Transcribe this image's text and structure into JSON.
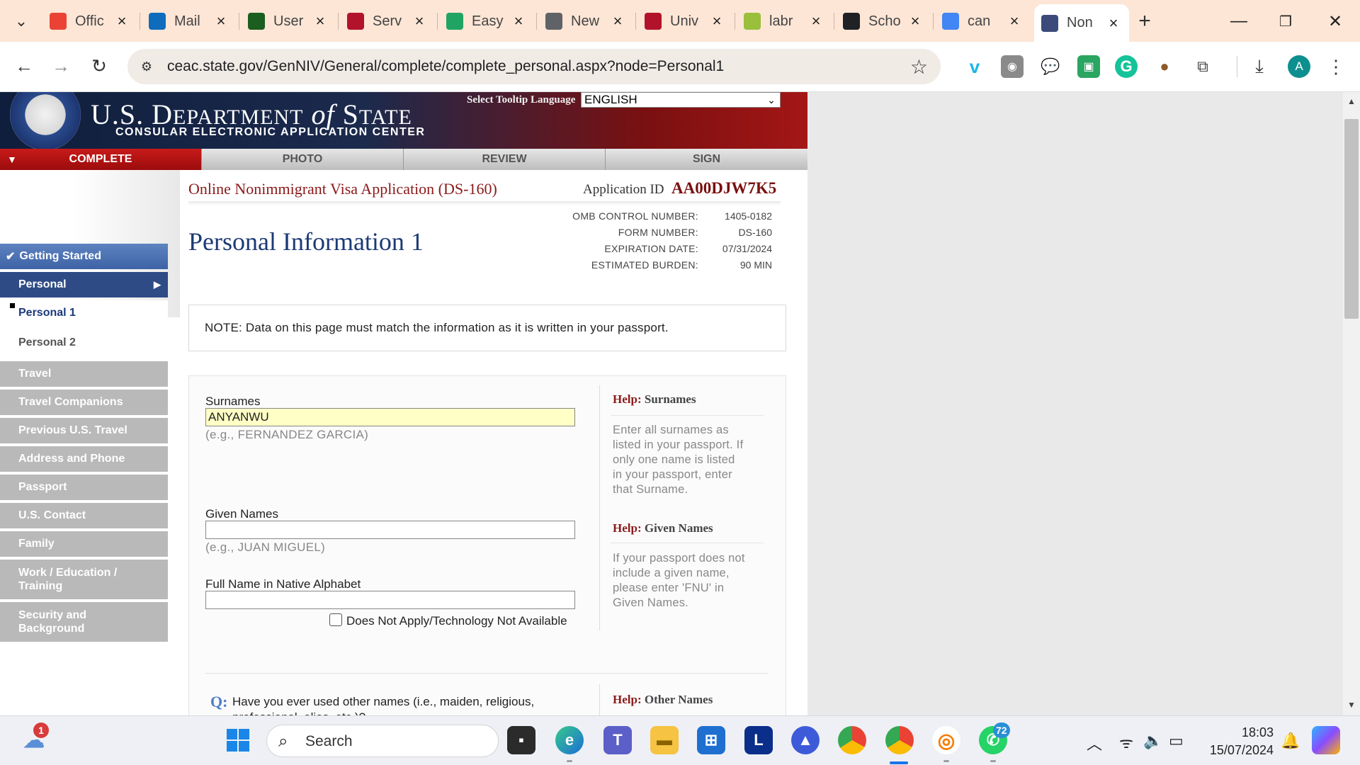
{
  "browser": {
    "tabs": [
      {
        "title": "Offic",
        "icon": "gmail-icon",
        "color": "#ea4335"
      },
      {
        "title": "Mail",
        "icon": "outlook-icon",
        "color": "#0f6cbd"
      },
      {
        "title": "User",
        "icon": "app-icon",
        "color": "#1b5e20"
      },
      {
        "title": "Serv",
        "icon": "university-logo-icon",
        "color": "#b3122b"
      },
      {
        "title": "Easy",
        "icon": "easy-icon",
        "color": "#1fa463"
      },
      {
        "title": "New",
        "icon": "globe-icon",
        "color": "#5f6368"
      },
      {
        "title": "Univ",
        "icon": "university-logo-icon",
        "color": "#b3122b"
      },
      {
        "title": "labr",
        "icon": "document-icon",
        "color": "#9abf3c"
      },
      {
        "title": "Scho",
        "icon": "g-icon",
        "color": "#202124"
      },
      {
        "title": "can",
        "icon": "google-icon",
        "color": "#4285f4"
      },
      {
        "title": "Non",
        "icon": "state-seal-icon",
        "color": "#3b4a7a"
      }
    ],
    "url": "ceac.state.gov/GenNIV/General/complete/complete_personal.aspx?node=Personal1",
    "profile_initial": "A"
  },
  "header": {
    "dept_line1_a": "U.S. D",
    "dept_line1_b": "EPARTMENT",
    "dept_of": "of",
    "dept_state_a": "S",
    "dept_state_b": "TATE",
    "dept_sub": "CONSULAR ELECTRONIC APPLICATION CENTER",
    "tooltip_label": "Select Tooltip Language",
    "tooltip_value": "ENGLISH"
  },
  "steps": [
    "COMPLETE",
    "PHOTO",
    "REVIEW",
    "SIGN"
  ],
  "nav": {
    "getting_started": "Getting Started",
    "personal": "Personal",
    "personal1": "Personal 1",
    "personal2": "Personal 2",
    "items": [
      "Travel",
      "Travel Companions",
      "Previous U.S. Travel",
      "Address and Phone",
      "Passport",
      "U.S. Contact",
      "Family"
    ],
    "work_line1": "Work / Education /",
    "work_line2": "Training",
    "security_line1": "Security and",
    "security_line2": "Background"
  },
  "main": {
    "app_title": "Online Nonimmigrant Visa Application (DS-160)",
    "app_id_label": "Application ID",
    "app_id": "AA00DJW7K5",
    "omb": [
      {
        "k": "OMB CONTROL NUMBER:",
        "v": "1405-0182"
      },
      {
        "k": "FORM NUMBER:",
        "v": "DS-160"
      },
      {
        "k": "EXPIRATION DATE:",
        "v": "07/31/2024"
      },
      {
        "k": "ESTIMATED BURDEN:",
        "v": "90 MIN"
      }
    ],
    "page_title": "Personal Information 1",
    "note": "NOTE: Data on this page must match the information as it is written in your passport."
  },
  "form": {
    "surnames_label": "Surnames",
    "surnames_value": "ANYANWU",
    "surnames_example": "(e.g., FERNANDEZ GARCIA)",
    "given_label": "Given Names",
    "given_value": "",
    "given_example": "(e.g., JUAN MIGUEL)",
    "native_label": "Full Name in Native Alphabet",
    "native_value": "",
    "does_not_apply": "Does Not Apply/Technology Not Available",
    "question_icon": "Q:",
    "question_line1": "Have you ever used other names (i.e., maiden, religious,",
    "question_line2": "professional, alias, etc.)?"
  },
  "help": {
    "help_word": "Help:",
    "surnames_title": "Surnames",
    "surnames_lines": [
      "Enter all surnames as",
      "listed in your passport. If",
      "only one name is listed",
      "in your passport, enter",
      "that Surname."
    ],
    "given_title": "Given Names",
    "given_lines": [
      "If your passport does not",
      "include a given name,",
      "please enter 'FNU' in",
      "Given Names."
    ],
    "other_title": "Other Names"
  },
  "taskbar": {
    "search_text": "Search",
    "weather_badge": "1",
    "whatsapp_badge": "72",
    "l_label": "L",
    "time": "18:03",
    "date": "15/07/2024"
  }
}
